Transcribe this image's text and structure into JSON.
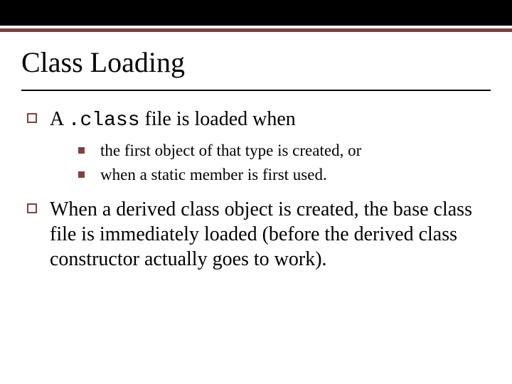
{
  "title": "Class Loading",
  "bullets": {
    "b1_prefix": "A ",
    "b1_code": ".class",
    "b1_suffix": " file is loaded when",
    "sub1": "the first object of that type is created, or",
    "sub2": "when a static member is first used.",
    "b2": "When a derived class object is created, the base class file is immediately loaded (before the derived class constructor actually goes to work)."
  }
}
